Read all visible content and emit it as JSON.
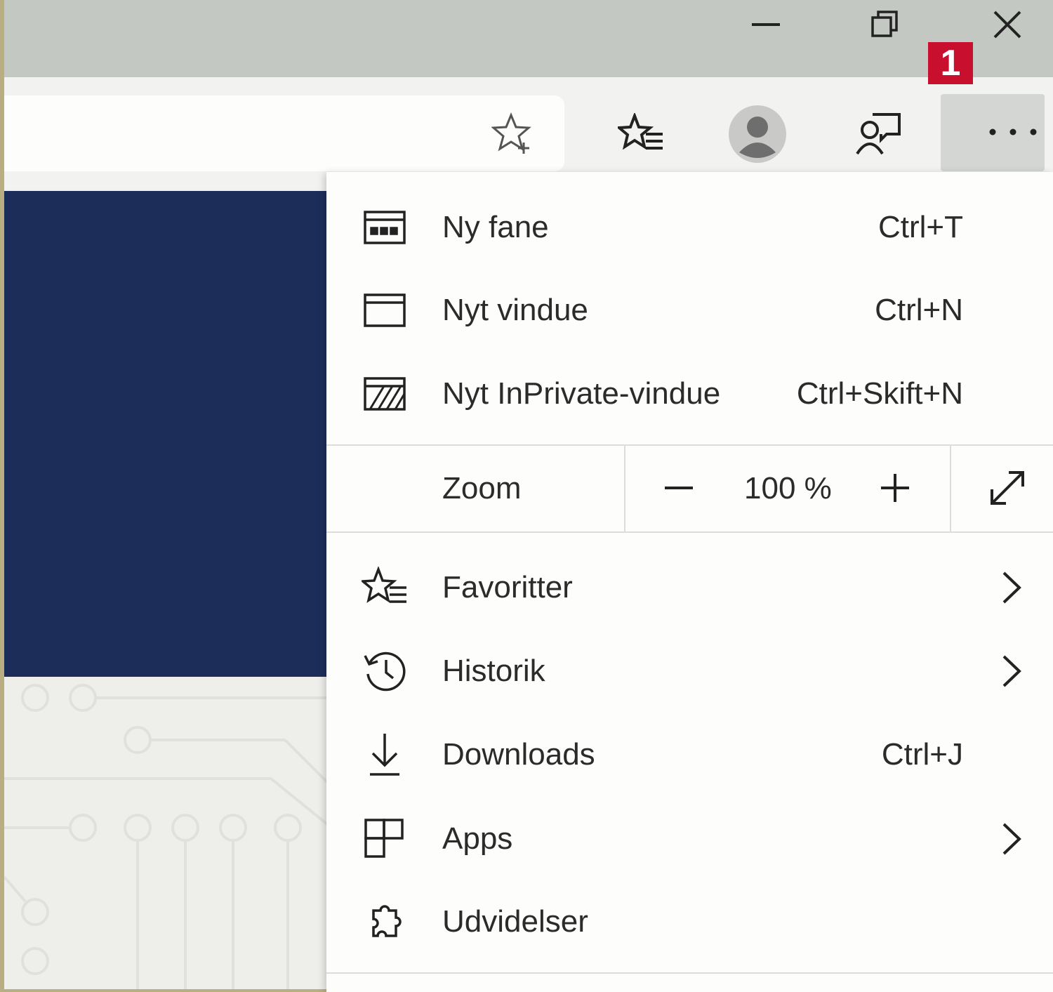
{
  "window_controls": {
    "minimize": "minimize-icon",
    "restore": "restore-icon",
    "close": "close-icon"
  },
  "toolbar": {
    "add_favorite_icon": "star-plus-icon",
    "favorites_icon": "favorites-list-icon",
    "profile_icon": "avatar-icon",
    "feedback_icon": "feedback-icon",
    "more_icon": "ellipsis-icon",
    "badge": "1",
    "badge_color": "#c8102e"
  },
  "menu": {
    "items_top": [
      {
        "label": "Ny fane",
        "shortcut": "Ctrl+T",
        "icon": "new-tab-icon"
      },
      {
        "label": "Nyt vindue",
        "shortcut": "Ctrl+N",
        "icon": "new-window-icon"
      },
      {
        "label": "Nyt InPrivate-vindue",
        "shortcut": "Ctrl+Skift+N",
        "icon": "inprivate-icon"
      }
    ],
    "zoom": {
      "label": "Zoom",
      "value": "100 %",
      "decrease_icon": "minus-icon",
      "increase_icon": "plus-icon",
      "fullscreen_icon": "expand-icon"
    },
    "items_bottom": [
      {
        "label": "Favoritter",
        "shortcut": "",
        "icon": "favorites-icon",
        "submenu": true
      },
      {
        "label": "Historik",
        "shortcut": "",
        "icon": "history-icon",
        "submenu": true
      },
      {
        "label": "Downloads",
        "shortcut": "Ctrl+J",
        "icon": "download-icon",
        "submenu": false
      },
      {
        "label": "Apps",
        "shortcut": "",
        "icon": "apps-icon",
        "submenu": true
      },
      {
        "label": "Udvidelser",
        "shortcut": "",
        "icon": "extensions-icon",
        "submenu": false
      }
    ]
  },
  "colors": {
    "titlebar": "#c4c8c2",
    "hero": "#1d2d5a",
    "menu_bg": "#fdfdfb"
  }
}
